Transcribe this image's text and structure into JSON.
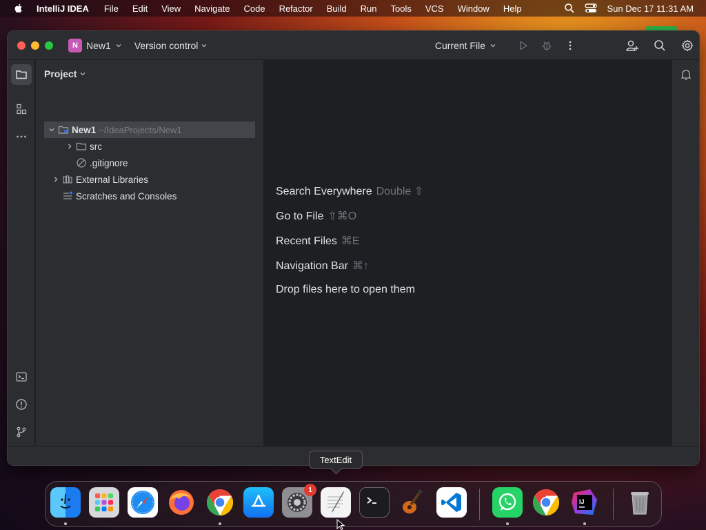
{
  "menubar": {
    "app_name": "IntelliJ IDEA",
    "items": [
      "File",
      "Edit",
      "View",
      "Navigate",
      "Code",
      "Refactor",
      "Build",
      "Run",
      "Tools",
      "VCS",
      "Window",
      "Help"
    ],
    "clock": "Sun Dec 17  11:31 AM"
  },
  "titlebar": {
    "project_badge": "N",
    "project_name": "New1",
    "version_control": "Version control",
    "run_config": "Current File"
  },
  "project_panel": {
    "title": "Project",
    "tree": [
      {
        "label": "New1",
        "path": "~/IdeaProjects/New1"
      },
      {
        "label": "src"
      },
      {
        "label": ".gitignore"
      },
      {
        "label": "External Libraries"
      },
      {
        "label": "Scratches and Consoles"
      }
    ]
  },
  "editor": {
    "hints": [
      {
        "label": "Search Everywhere",
        "shortcut": "Double ⇧"
      },
      {
        "label": "Go to File",
        "shortcut": "⇧⌘O"
      },
      {
        "label": "Recent Files",
        "shortcut": "⌘E"
      },
      {
        "label": "Navigation Bar",
        "shortcut": "⌘↑"
      },
      {
        "label": "Drop files here to open them",
        "shortcut": ""
      }
    ]
  },
  "tooltip": "TextEdit",
  "dock": {
    "system_settings_badge": "1",
    "apps": [
      "finder",
      "launchpad",
      "safari",
      "firefox",
      "chrome",
      "app-store",
      "system-settings",
      "textedit",
      "terminal",
      "garageband",
      "vscode",
      "whatsapp",
      "chrome",
      "intellij",
      "trash"
    ]
  },
  "colors": {
    "ide_bg": "#1e1f22",
    "panel_bg": "#2b2d30",
    "selection": "#43454a",
    "project_badge": "#c75ab5"
  }
}
